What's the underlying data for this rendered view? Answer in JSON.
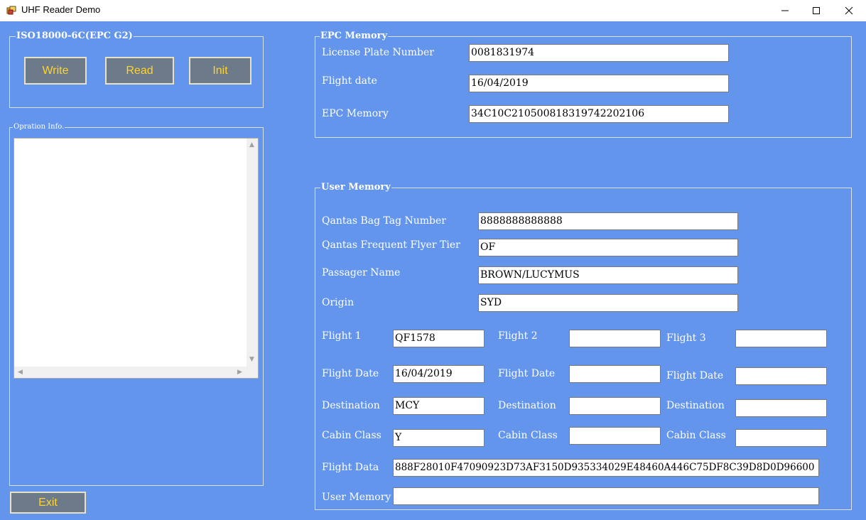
{
  "window": {
    "title": "UHF Reader Demo"
  },
  "protocol_group": {
    "legend": "ISO18000-6C(EPC G2)",
    "write_label": "Write",
    "read_label": "Read",
    "init_label": "Init"
  },
  "operation_group": {
    "legend": "Opration Info."
  },
  "exit_label": "Exit",
  "epc_group": {
    "legend": "EPC Memory",
    "license_label": "License Plate Number",
    "license_value": "0081831974",
    "flight_date_label": "Flight date",
    "flight_date_value": "16/04/2019",
    "epc_label": "EPC Memory",
    "epc_value": "34C10C210500818319742202106"
  },
  "user_group": {
    "legend": "User Memory",
    "bag_tag_label": "Qantas Bag Tag Number",
    "bag_tag_value": "8888888888888",
    "ff_tier_label": "Qantas Frequent Flyer Tier",
    "ff_tier_value": "OF",
    "passenger_label": "Passager Name",
    "passenger_value": "BROWN/LUCYMUS",
    "origin_label": "Origin",
    "origin_value": "SYD",
    "flight1_label": "Flight 1",
    "flight1_value": "QF1578",
    "flight2_label": "Flight 2",
    "flight2_value": "",
    "flight3_label": "Flight 3",
    "flight3_value": "",
    "fdate1_label": "Flight Date",
    "fdate1_value": "16/04/2019",
    "fdate2_label": "Flight Date",
    "fdate2_value": "",
    "fdate3_label": "Flight Date",
    "fdate3_value": "",
    "dest1_label": "Destination",
    "dest1_value": "MCY",
    "dest2_label": "Destination",
    "dest2_value": "",
    "dest3_label": "Destination",
    "dest3_value": "",
    "cabin1_label": "Cabin Class",
    "cabin1_value": "Y",
    "cabin2_label": "Cabin Class",
    "cabin2_value": "",
    "cabin3_label": "Cabin Class",
    "cabin3_value": "",
    "flight_data_label": "Flight Data",
    "flight_data_value": "888F28010F47090923D73AF3150D935334029E48460A446C75DF8C39D8D0D96600",
    "user_memory_label": "User Memory",
    "user_memory_value": ""
  }
}
